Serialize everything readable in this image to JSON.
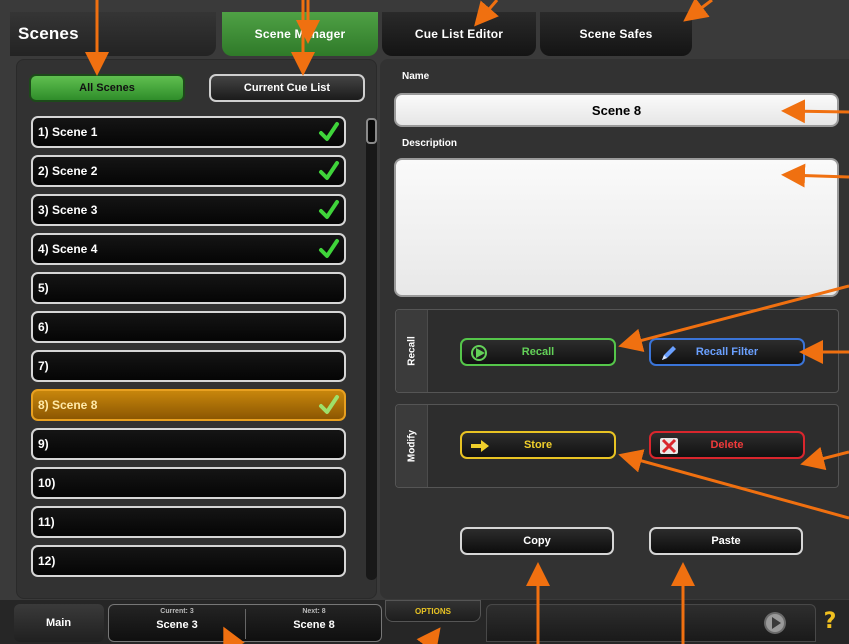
{
  "tabs": {
    "scenes": "Scenes",
    "manager": "Scene Manager",
    "cue_editor": "Cue List Editor",
    "safes": "Scene Safes"
  },
  "list_filters": {
    "all": "All Scenes",
    "current_cue": "Current Cue List"
  },
  "scenes": [
    {
      "label": "1) Scene 1",
      "stored": true,
      "selected": false
    },
    {
      "label": "2) Scene 2",
      "stored": true,
      "selected": false
    },
    {
      "label": "3) Scene 3",
      "stored": true,
      "selected": false
    },
    {
      "label": "4) Scene 4",
      "stored": true,
      "selected": false
    },
    {
      "label": "5)",
      "stored": false,
      "selected": false
    },
    {
      "label": "6)",
      "stored": false,
      "selected": false
    },
    {
      "label": "7)",
      "stored": false,
      "selected": false
    },
    {
      "label": "8) Scene 8",
      "stored": true,
      "selected": true
    },
    {
      "label": "9)",
      "stored": false,
      "selected": false
    },
    {
      "label": "10)",
      "stored": false,
      "selected": false
    },
    {
      "label": "11)",
      "stored": false,
      "selected": false
    },
    {
      "label": "12)",
      "stored": false,
      "selected": false
    }
  ],
  "details": {
    "name_label": "Name",
    "name_value": "Scene 8",
    "description_label": "Description",
    "description_value": ""
  },
  "recall": {
    "group_label": "Recall",
    "recall_button": "Recall",
    "filter_button": "Recall Filter"
  },
  "modify": {
    "group_label": "Modify",
    "store_button": "Store",
    "delete_button": "Delete"
  },
  "clipboard": {
    "copy_button": "Copy",
    "paste_button": "Paste"
  },
  "bottom_bar": {
    "main_label": "Main",
    "current_caption": "Current: 3",
    "current_scene": "Scene 3",
    "next_caption": "Next: 8",
    "next_scene": "Scene 8",
    "options_label": "OPTIONS",
    "help_label": "?"
  },
  "colors": {
    "accent_green": "#3c9a34",
    "selected_scene": "#b27708",
    "annotation_arrow": "#f07010"
  }
}
